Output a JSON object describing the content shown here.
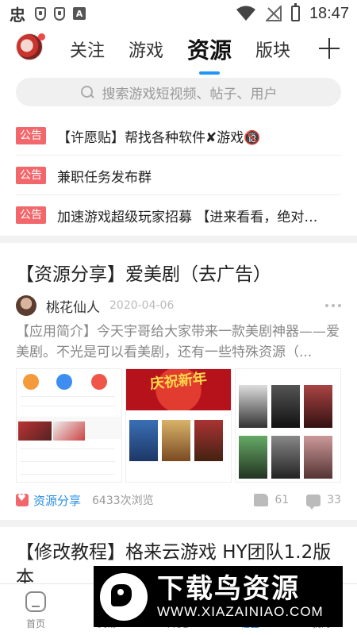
{
  "status_bar": {
    "app_icon": "忠",
    "a_badge": "A",
    "time": "18:47"
  },
  "header": {
    "tabs": [
      {
        "label": "关注",
        "active": false
      },
      {
        "label": "游戏",
        "active": false
      },
      {
        "label": "资源",
        "active": true
      },
      {
        "label": "版块",
        "active": false
      }
    ]
  },
  "search": {
    "placeholder": "搜索游戏短视频、帖子、用户"
  },
  "notices": [
    {
      "tag": "公告",
      "text": "【许愿贴】帮找各种软件✘游戏🔞"
    },
    {
      "tag": "公告",
      "text": "兼职任务发布群"
    },
    {
      "tag": "公告",
      "text": "加速游戏超级玩家招募 【进来看看，绝对…"
    }
  ],
  "post": {
    "title": "【资源分享】爱美剧（去广告）",
    "author": "桃花仙人",
    "date": "2020-04-06",
    "body": "【应用简介】今天宇哥给大家带来一款美剧神器——爱美剧。不光是可以看美剧，还有一些特殊资源（...",
    "thumb2_banner": "庆祝新年",
    "category": "资源分享",
    "views": "6433次浏览",
    "likes": "61",
    "comments": "33"
  },
  "post2": {
    "title": "【修改教程】格来云游戏 HY团队1.2版本"
  },
  "bottom_nav": [
    {
      "label": "首页",
      "icon": "home-icon",
      "active": false
    },
    {
      "label": "交易",
      "icon": "trade-icon",
      "active": false
    },
    {
      "label": "MOD",
      "icon": "mod-icon",
      "active": false
    },
    {
      "label": "社区",
      "icon": "community-icon",
      "active": true
    },
    {
      "label": "我的",
      "icon": "profile-icon",
      "active": false
    }
  ],
  "watermark": {
    "title": "下载鸟资源",
    "url": "WWW.XIAZAINIAO.COM"
  },
  "colors": {
    "accent_blue": "#2196f3",
    "notice_red": "#f2676b",
    "link_blue": "#2a8fe8"
  }
}
